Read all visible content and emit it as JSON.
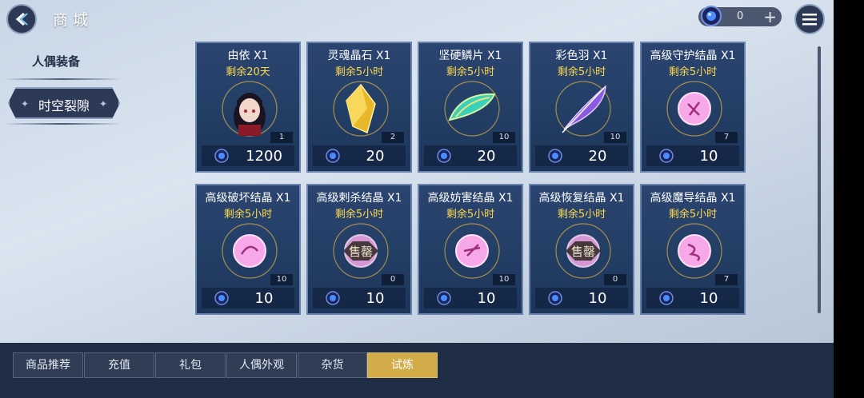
{
  "header": {
    "title": "商城"
  },
  "currency": {
    "amount": "0",
    "plus_label": "+"
  },
  "sidebar": {
    "heading": "人偶装备",
    "active_item": "时空裂隙"
  },
  "colors": {
    "accent_gold": "#d2ac48",
    "timer_yellow": "#ffd84a",
    "card_blue": "#244067"
  },
  "items": [
    {
      "name": "由依 X1",
      "timer": "剩余20天",
      "qty": "1",
      "price": "1200",
      "icon": "character-portrait"
    },
    {
      "name": "灵魂晶石 X1",
      "timer": "剩余5小时",
      "qty": "2",
      "price": "20",
      "icon": "gold-crystal-icon"
    },
    {
      "name": "坚硬鳞片 X1",
      "timer": "剩余5小时",
      "qty": "10",
      "price": "20",
      "icon": "scale-icon"
    },
    {
      "name": "彩色羽 X1",
      "timer": "剩余5小时",
      "qty": "10",
      "price": "20",
      "icon": "feather-icon"
    },
    {
      "name": "高级守护结晶 X1",
      "timer": "剩余5小时",
      "qty": "7",
      "price": "10",
      "icon": "crystal-orb-icon"
    },
    {
      "name": "高级破坏结晶 X1",
      "timer": "剩余5小时",
      "qty": "10",
      "price": "10",
      "icon": "crystal-orb-icon"
    },
    {
      "name": "高级剌杀结晶 X1",
      "timer": "剩余5小时",
      "qty": "0",
      "price": "10",
      "icon": "crystal-orb-icon",
      "soldout": "售罄"
    },
    {
      "name": "高级妨害结晶 X1",
      "timer": "剩余5小时",
      "qty": "10",
      "price": "10",
      "icon": "crystal-orb-icon"
    },
    {
      "name": "高级恢复结晶 X1",
      "timer": "剩余5小时",
      "qty": "0",
      "price": "10",
      "icon": "crystal-orb-icon",
      "soldout": "售罄"
    },
    {
      "name": "高级魔导结晶 X1",
      "timer": "剩余5小时",
      "qty": "7",
      "price": "10",
      "icon": "crystal-orb-icon"
    }
  ],
  "tabs": [
    {
      "label": "商品推荐"
    },
    {
      "label": "充值"
    },
    {
      "label": "礼包"
    },
    {
      "label": "人偶外观"
    },
    {
      "label": "杂货"
    },
    {
      "label": "试炼",
      "active": true
    }
  ]
}
